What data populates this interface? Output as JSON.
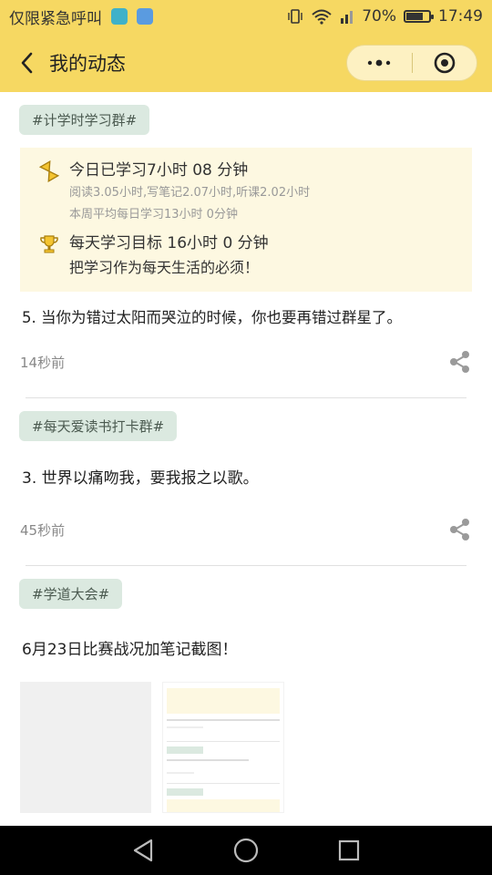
{
  "statusbar": {
    "carrier": "仅限紧急呼叫",
    "battery_text": "70%",
    "battery_level": 0.7,
    "time": "17:49"
  },
  "navbar": {
    "title": "我的动态",
    "more_icon": "more-dots-icon",
    "close_icon": "target-circle-icon"
  },
  "posts": [
    {
      "tag": "#计学时学习群#",
      "card": {
        "study_today": "今日已学习7小时 08 分钟",
        "breakdown": "阅读3.05小时,写笔记2.07小时,听课2.02小时",
        "weekly_avg": "本周平均每日学习13小时 0分钟",
        "goal": "每天学习目标 16小时 0 分钟",
        "motto": "把学习作为每天生活的必须！"
      },
      "text": "5. 当你为错过太阳而哭泣的时候，你也要再错过群星了。",
      "time": "14秒前"
    },
    {
      "tag": "#每天爱读书打卡群#",
      "text": "3. 世界以痛吻我，要我报之以歌。",
      "time": "45秒前"
    },
    {
      "tag": "#学道大会#",
      "text": "6月23日比赛战况加笔记截图！",
      "time": ""
    }
  ],
  "colors": {
    "header": "#f6d862",
    "tag_bg": "#dbe9e0",
    "card_bg": "#fdf8e1"
  }
}
